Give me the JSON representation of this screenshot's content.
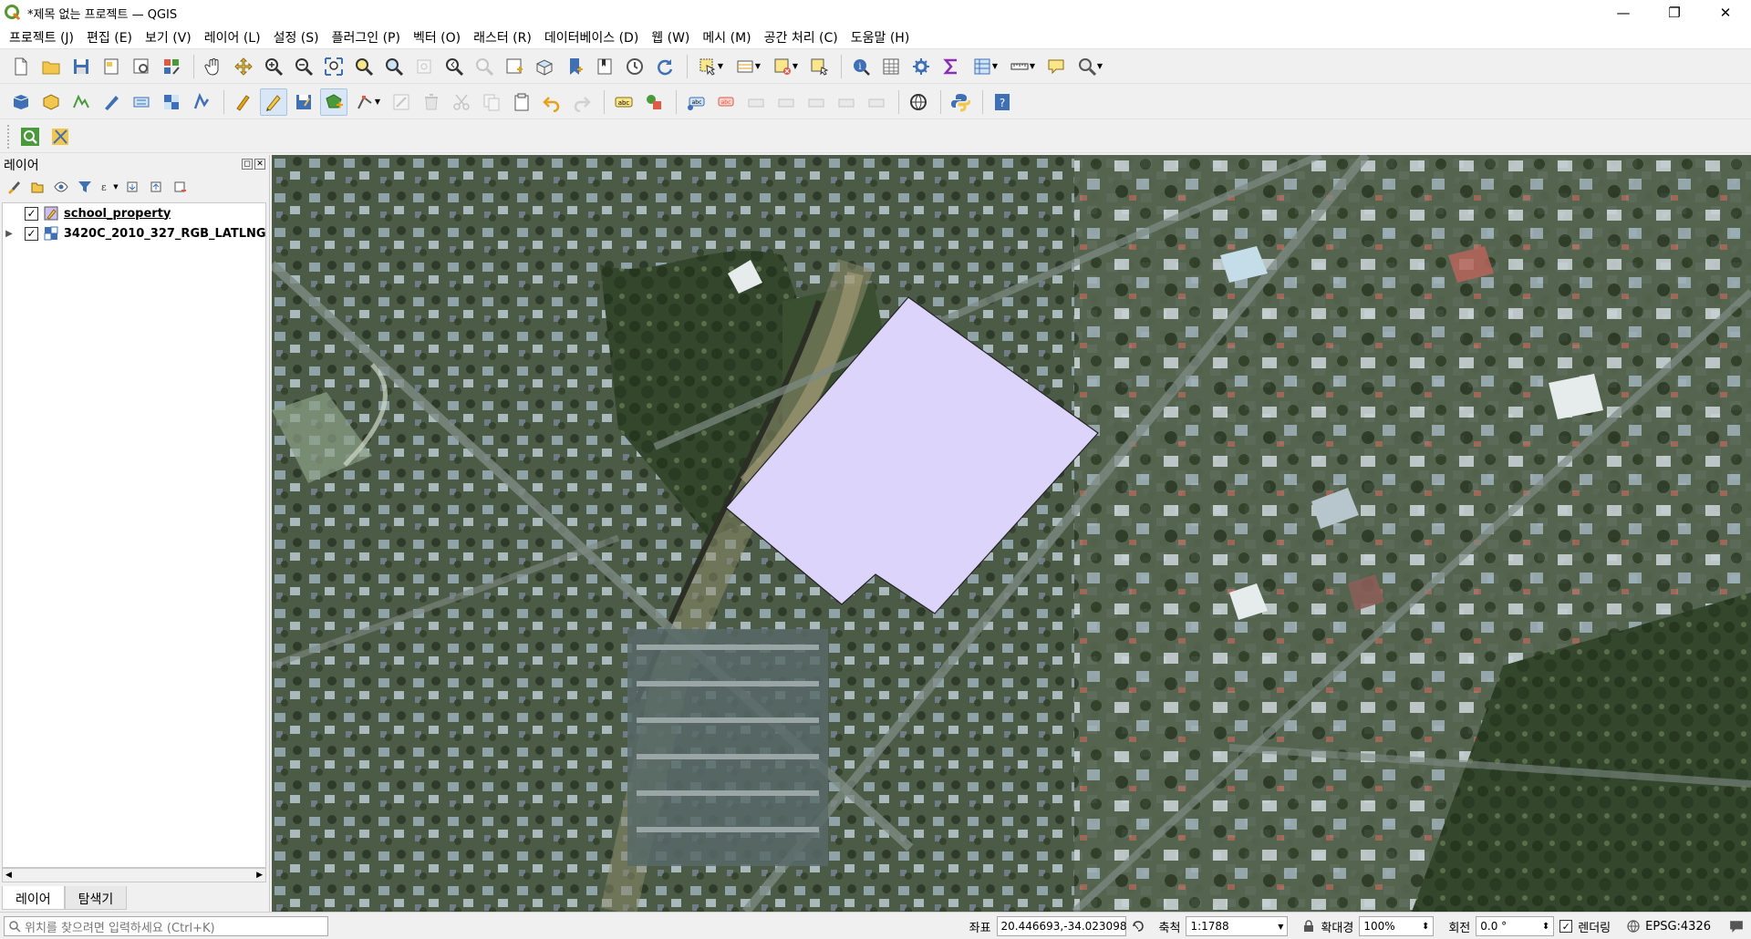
{
  "window": {
    "title": "*제목 없는 프로젝트 — QGIS",
    "minimize": "—",
    "restore": "❐",
    "close": "✕"
  },
  "menu": [
    "프로젝트 (J)",
    "편집 (E)",
    "보기 (V)",
    "레이어 (L)",
    "설정 (S)",
    "플러그인 (P)",
    "벡터 (O)",
    "래스터 (R)",
    "데이터베이스 (D)",
    "웹 (W)",
    "메시 (M)",
    "공간 처리 (C)",
    "도움말 (H)"
  ],
  "layers_panel": {
    "title": "레이어",
    "float_btn": "◻",
    "close_btn": "✕",
    "layers": [
      {
        "name": "school_property",
        "checked": "✓",
        "expander": ""
      },
      {
        "name": "3420C_2010_327_RGB_LATLNG",
        "checked": "✓",
        "expander": "▶"
      }
    ],
    "scroll_left": "◀",
    "scroll_right": "▶",
    "tabs": [
      "레이어",
      "탐색기"
    ]
  },
  "status": {
    "locator_placeholder": "위치를 찾으려면 입력하세요 (Ctrl+K)",
    "coord_label": "좌표",
    "coord_value": "20.446693,-34.023098",
    "scale_label": "축척",
    "scale_value": "1:1788",
    "magnifier_label": "확대경",
    "magnifier_value": "100%",
    "rotation_label": "회전",
    "rotation_value": "0.0 °",
    "render_label": "렌더링",
    "render_checked": "✓",
    "crs": "EPSG:4326",
    "combo_arrow": "▼",
    "spin_arrow": "⬍"
  },
  "colors": {
    "polygon_fill": "#dcd4fa",
    "polygon_stroke": "#222222",
    "accent": "#3b7fd4"
  }
}
